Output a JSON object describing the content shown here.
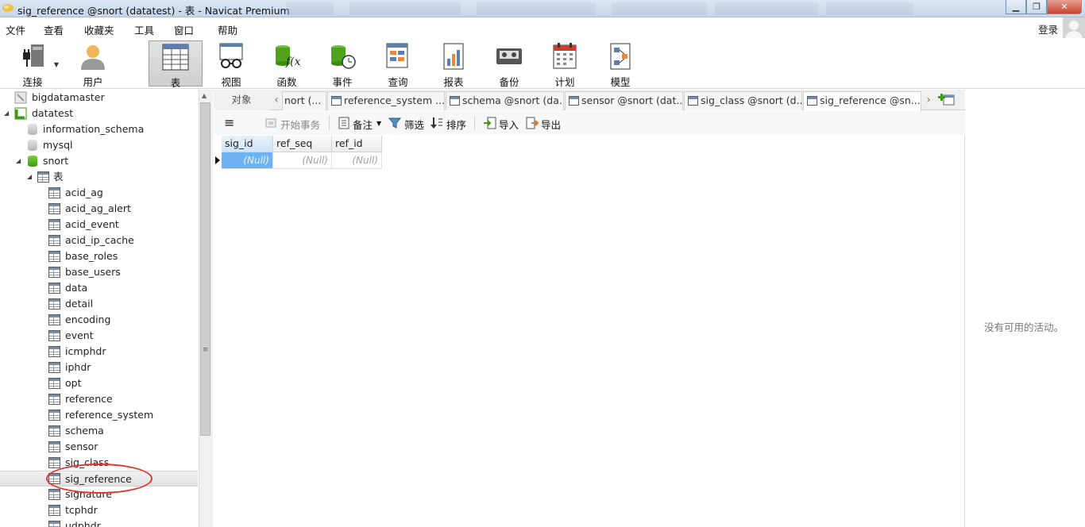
{
  "window": {
    "title": "sig_reference @snort (datatest) - 表 - Navicat Premium"
  },
  "menu": [
    "文件",
    "查看",
    "收藏夹",
    "工具",
    "窗口",
    "帮助"
  ],
  "login_label": "登录",
  "toolbar": {
    "connect": "连接",
    "user": "用户",
    "table": "表",
    "view": "视图",
    "function": "函数",
    "event": "事件",
    "query": "查询",
    "report": "报表",
    "backup": "备份",
    "schedule": "计划",
    "model": "模型"
  },
  "tree": {
    "connections": [
      "bigdatamaster",
      "datatest"
    ],
    "databases": [
      "information_schema",
      "mysql",
      "snort"
    ],
    "tables_folder": "表",
    "tables": [
      "acid_ag",
      "acid_ag_alert",
      "acid_event",
      "acid_ip_cache",
      "base_roles",
      "base_users",
      "data",
      "detail",
      "encoding",
      "event",
      "icmphdr",
      "iphdr",
      "opt",
      "reference",
      "reference_system",
      "schema",
      "sensor",
      "sig_class",
      "sig_reference",
      "signature",
      "tcphdr",
      "udphdr"
    ],
    "selected": "sig_reference"
  },
  "tabs": {
    "objects": "对象",
    "items": [
      "nort (...",
      "reference_system ...",
      "schema @snort (da...",
      "sensor @snort (dat...",
      "sig_class @snort (d...",
      "sig_reference @sn..."
    ],
    "active_index": 5
  },
  "object_toolbar": {
    "begin_transaction": "开始事务",
    "memo": "备注",
    "filter": "筛选",
    "sort": "排序",
    "import": "导入",
    "export": "导出"
  },
  "grid": {
    "columns": [
      "sig_id",
      "ref_seq",
      "ref_id"
    ],
    "rows": [
      [
        "(Null)",
        "(Null)",
        "(Null)"
      ]
    ]
  },
  "right_panel": {
    "empty_text": "没有可用的活动。"
  },
  "colors": {
    "selection": "#6fb2f4",
    "annotation": "#e5322d",
    "db_green": "#3e9b12"
  }
}
